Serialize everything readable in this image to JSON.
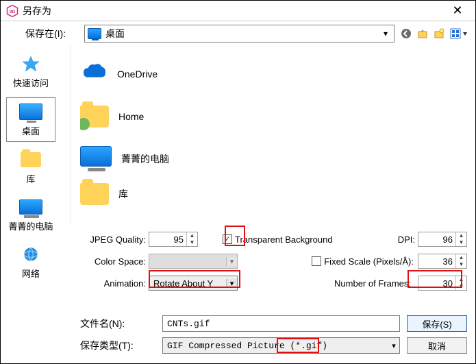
{
  "window": {
    "title": "另存为"
  },
  "save_in": {
    "label": "保存在(I):",
    "value": "桌面",
    "tools": {
      "back": "back-icon",
      "up": "up-icon",
      "newfolder": "new-folder-icon",
      "views": "views-icon"
    }
  },
  "sidebar": {
    "items": [
      {
        "label": "快速访问"
      },
      {
        "label": "桌面"
      },
      {
        "label": "库"
      },
      {
        "label": "菁菁的电脑"
      },
      {
        "label": "网络"
      }
    ],
    "selected": 1
  },
  "files": [
    {
      "name": "OneDrive"
    },
    {
      "name": "Home"
    },
    {
      "name": "菁菁的电脑"
    },
    {
      "name": "库"
    }
  ],
  "options": {
    "jpeg_label": "JPEG Quality:",
    "jpeg_value": "95",
    "transparent_label": "Transparent Background",
    "transparent_checked": true,
    "dpi_label": "DPI:",
    "dpi_value": "96",
    "colorspace_label": "Color Space:",
    "colorspace_value": "",
    "fixed_label": "Fixed Scale (Pixels/Å):",
    "fixed_checked": false,
    "fixed_value": "36",
    "animation_label": "Animation:",
    "animation_value": "Rotate About Y",
    "frames_label": "Number of Frames:",
    "frames_value": "30"
  },
  "bottom": {
    "filename_label": "文件名(N):",
    "filename_value": "CNTs.gif",
    "filetype_label": "保存类型(T):",
    "filetype_value": "GIF Compressed Picture (*.gif)",
    "save_label": "保存(S)",
    "cancel_label": "取消"
  }
}
